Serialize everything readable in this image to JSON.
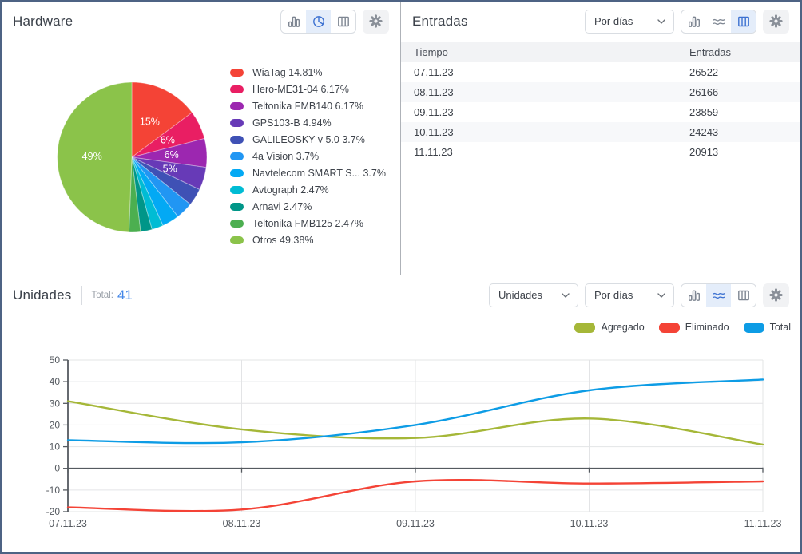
{
  "theme": {
    "frame_border": "#4D6384",
    "panel_divider": "#AEB2B8",
    "icon_active_color": "#3C71D1",
    "icon_active_bg": "#E4EDFA",
    "icon_inactive_color": "#7E8692",
    "gear_bg": "#F1F2F4",
    "total_accent_blue": "#4487E8",
    "table_header_bg": "#F2F3F5",
    "table_alt_row_bg": "#F7F8FA",
    "axis_color": "#555A60",
    "grid_color": "#E3E4E6"
  },
  "hardware": {
    "title": "Hardware",
    "toolbar": {
      "icons": [
        "bar-chart",
        "pie-chart",
        "table"
      ],
      "active": "pie-chart",
      "settings_icon": "gear"
    },
    "legend_labels": [
      "WiaTag 14.81%",
      "Hero-ME31-04 6.17%",
      "Teltonika FMB140 6.17%",
      "GPS103-B 4.94%",
      "GALILEOSKY v 5.0 3.7%",
      "4a Vision 3.7%",
      "Navtelecom SMART S... 3.7%",
      "Avtograph 2.47%",
      "Arnavi 2.47%",
      "Teltonika FMB125 2.47%",
      "Otros 49.38%"
    ]
  },
  "entradas": {
    "title": "Entradas",
    "period_select": {
      "value": "Por días"
    },
    "toolbar": {
      "icons": [
        "bar-chart",
        "line-chart",
        "table"
      ],
      "active": "table",
      "settings_icon": "gear"
    },
    "table": {
      "columns": [
        "Tiempo",
        "Entradas"
      ],
      "rows": [
        [
          "07.11.23",
          "26522"
        ],
        [
          "08.11.23",
          "26166"
        ],
        [
          "09.11.23",
          "23859"
        ],
        [
          "10.11.23",
          "24243"
        ],
        [
          "11.11.23",
          "20913"
        ]
      ]
    }
  },
  "unidades": {
    "title": "Unidades",
    "total_label": "Total:",
    "total_value": "41",
    "type_select": {
      "value": "Unidades"
    },
    "period_select": {
      "value": "Por días"
    },
    "toolbar": {
      "icons": [
        "bar-chart",
        "line-chart",
        "table"
      ],
      "active": "line-chart",
      "settings_icon": "gear"
    },
    "legend": [
      {
        "label": "Agregado",
        "color": "#A5B738"
      },
      {
        "label": "Eliminado",
        "color": "#F44336"
      },
      {
        "label": "Total",
        "color": "#0D9CE5"
      }
    ]
  },
  "chart_data": [
    {
      "type": "pie",
      "title": "Hardware",
      "categories": [
        "WiaTag",
        "Hero-ME31-04",
        "Teltonika FMB140",
        "GPS103-B",
        "GALILEOSKY v 5.0",
        "4a Vision",
        "Navtelecom SMART S...",
        "Avtograph",
        "Arnavi",
        "Teltonika FMB125",
        "Otros"
      ],
      "values": [
        14.81,
        6.17,
        6.17,
        4.94,
        3.7,
        3.7,
        3.7,
        2.47,
        2.47,
        2.47,
        49.38
      ],
      "colors": [
        "#F44336",
        "#E91E63",
        "#9C27B0",
        "#673AB7",
        "#3F51B5",
        "#2196F3",
        "#03A9F4",
        "#00BCD4",
        "#009688",
        "#4CAF50",
        "#8BC34A"
      ],
      "slice_labels": [
        "15%",
        "6%",
        "6%",
        "5%",
        "",
        "",
        "",
        "",
        "",
        "",
        "49%"
      ],
      "start_angle_deg": 0,
      "direction": "clockwise",
      "legend_position": "right"
    },
    {
      "type": "line",
      "title": "Unidades",
      "x": [
        "07.11.23",
        "08.11.23",
        "09.11.23",
        "10.11.23",
        "11.11.23"
      ],
      "series": [
        {
          "name": "Agregado",
          "color": "#A5B738",
          "values": [
            31,
            18,
            14,
            23,
            11
          ]
        },
        {
          "name": "Eliminado",
          "color": "#F44336",
          "values": [
            -18,
            -19,
            -6,
            -7,
            -6
          ]
        },
        {
          "name": "Total",
          "color": "#0D9CE5",
          "values": [
            13,
            12,
            20,
            36,
            41
          ]
        }
      ],
      "ylim": [
        -20,
        50
      ],
      "ytick_step": 10,
      "yticks": [
        50,
        40,
        30,
        20,
        10,
        0,
        -10,
        -20
      ],
      "grid": true,
      "smooth": true,
      "legend_position": "top-right"
    }
  ]
}
